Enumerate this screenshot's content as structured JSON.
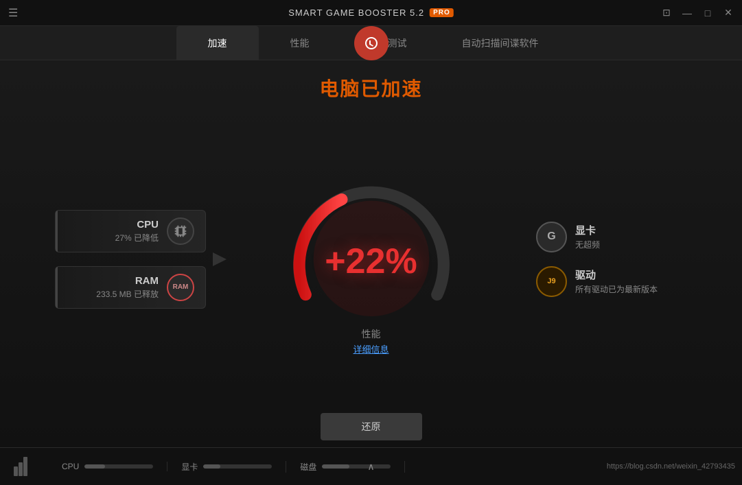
{
  "titleBar": {
    "title": "Smart Game Booster 5.2",
    "proBadge": "PRO",
    "hamburgerIcon": "☰",
    "screenshotIcon": "⊡",
    "minimizeIcon": "—",
    "restoreIcon": "□",
    "closeIcon": "✕"
  },
  "tabs": [
    {
      "id": "accelerate",
      "label": "加速",
      "active": true
    },
    {
      "id": "performance",
      "label": "性能",
      "active": false
    },
    {
      "id": "test",
      "label": "运行测试",
      "active": false
    },
    {
      "id": "scan",
      "label": "自动扫描间谍软件",
      "active": false
    }
  ],
  "main": {
    "acceleratedTitle": "电脑已加速",
    "gaugeValue": "+22%",
    "gaugeLabelMain": "性能",
    "gaugeLabelDetail": "详细信息",
    "restoreButton": "还原"
  },
  "leftStats": [
    {
      "label": "CPU",
      "value": "27% 已降低",
      "iconText": "⊞"
    },
    {
      "label": "RAM",
      "value": "233.5 MB 已释放",
      "iconText": "RAM"
    }
  ],
  "rightStats": [
    {
      "label": "显卡",
      "value": "无超频",
      "iconText": "G"
    },
    {
      "label": "驱动",
      "value": "所有驱动已为最新版本",
      "iconText": "J9"
    }
  ],
  "bottomBar": {
    "cpuLabel": "CPU",
    "gpuLabel": "显卡",
    "diskLabel": "磁盘",
    "cpuProgress": 30,
    "gpuProgress": 25,
    "diskProgress": 40,
    "url": "https://blog.csdn.net/weixin_42793435",
    "upArrow": "∧"
  }
}
